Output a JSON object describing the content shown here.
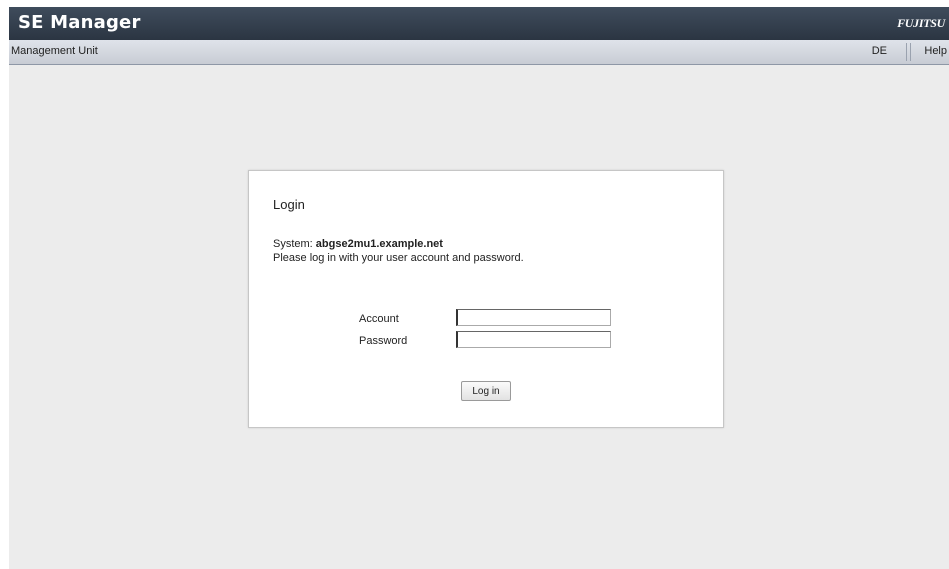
{
  "header": {
    "app_title": "SE Manager",
    "brand": "FUJITSU"
  },
  "subbar": {
    "unit_label": "Management Unit",
    "language_link": "DE",
    "help_link": "Help"
  },
  "login": {
    "title": "Login",
    "system_prefix": "System:",
    "system_name": "abgse2mu1.example.net",
    "instructions": "Please log in with your user account and password.",
    "account_label": "Account",
    "account_value": "",
    "password_label": "Password",
    "password_value": "",
    "submit_label": "Log in"
  },
  "colors": {
    "titlebar": "#2f3a48",
    "subbar": "#d4d8df",
    "background": "#ececec",
    "panel": "#ffffff"
  }
}
